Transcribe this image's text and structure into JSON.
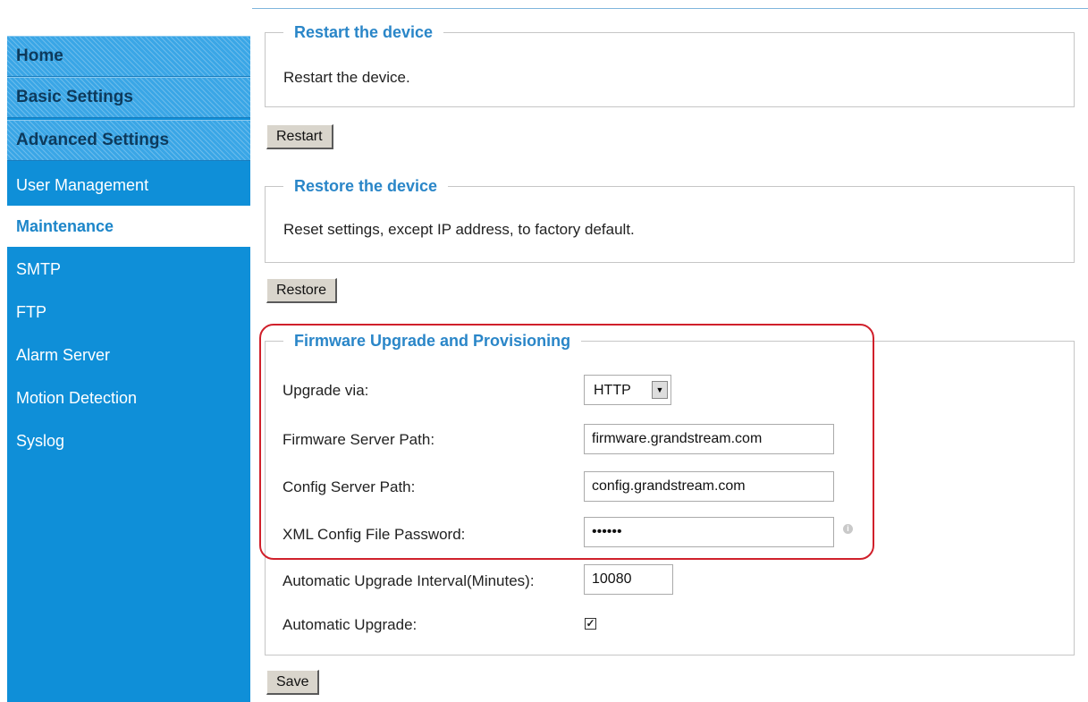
{
  "sidebar": {
    "sections": [
      "Home",
      "Basic Settings",
      "Advanced Settings"
    ],
    "items": [
      "User Management",
      "Maintenance",
      "SMTP",
      "FTP",
      "Alarm Server",
      "Motion Detection",
      "Syslog"
    ],
    "active_item": "Maintenance"
  },
  "restart": {
    "legend": "Restart the device",
    "description": "Restart the device.",
    "button": "Restart"
  },
  "restore": {
    "legend": "Restore the device",
    "description": "Reset settings, except IP address, to factory default.",
    "button": "Restore"
  },
  "firmware": {
    "legend": "Firmware Upgrade and Provisioning",
    "upgrade_via_label": "Upgrade via:",
    "upgrade_via_value": "HTTP",
    "firmware_path_label": "Firmware Server Path:",
    "firmware_path_value": "firmware.grandstream.com",
    "config_path_label": "Config Server Path:",
    "config_path_value": "config.grandstream.com",
    "xml_password_label": "XML Config File Password:",
    "xml_password_value": "secret",
    "interval_label": "Automatic Upgrade Interval(Minutes):",
    "interval_value": "10080",
    "auto_upgrade_label": "Automatic Upgrade:",
    "auto_upgrade_checked": true,
    "save_button": "Save"
  },
  "colors": {
    "sidebar_bg": "#0f8fd8",
    "legend_text": "#2a86c8",
    "highlight": "#d0202b"
  }
}
